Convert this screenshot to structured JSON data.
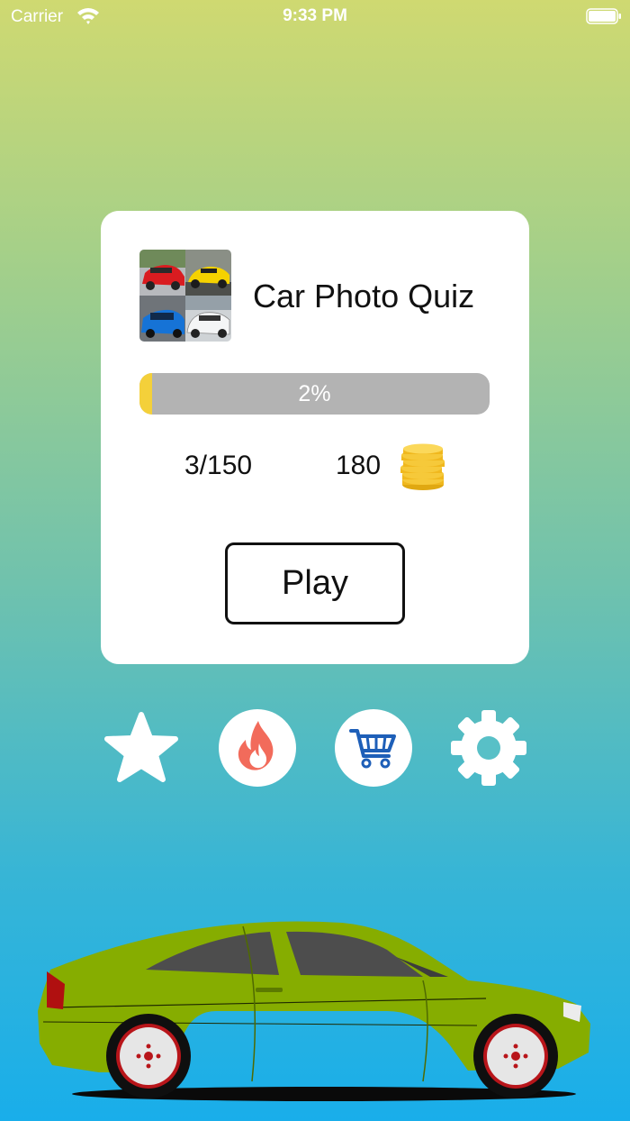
{
  "status_bar": {
    "carrier": "Carrier",
    "time": "9:33 PM"
  },
  "quiz": {
    "title": "Car Photo Quiz",
    "progress_percent": 2,
    "progress_label": "2%",
    "levels_completed": "3/150",
    "coins": "180",
    "play_label": "Play"
  },
  "actions": [
    {
      "name": "favorites",
      "icon": "star-icon"
    },
    {
      "name": "hot",
      "icon": "flame-icon"
    },
    {
      "name": "shop",
      "icon": "cart-icon"
    },
    {
      "name": "settings",
      "icon": "gear-icon"
    }
  ],
  "colors": {
    "gradient_top": "#cfd971",
    "gradient_bottom": "#19aeea",
    "progress_fill": "#f4d03a",
    "progress_track": "#b3b3b3",
    "flame": "#f26b5b",
    "cart": "#1e5fb8",
    "car_body": "#86ad00"
  }
}
